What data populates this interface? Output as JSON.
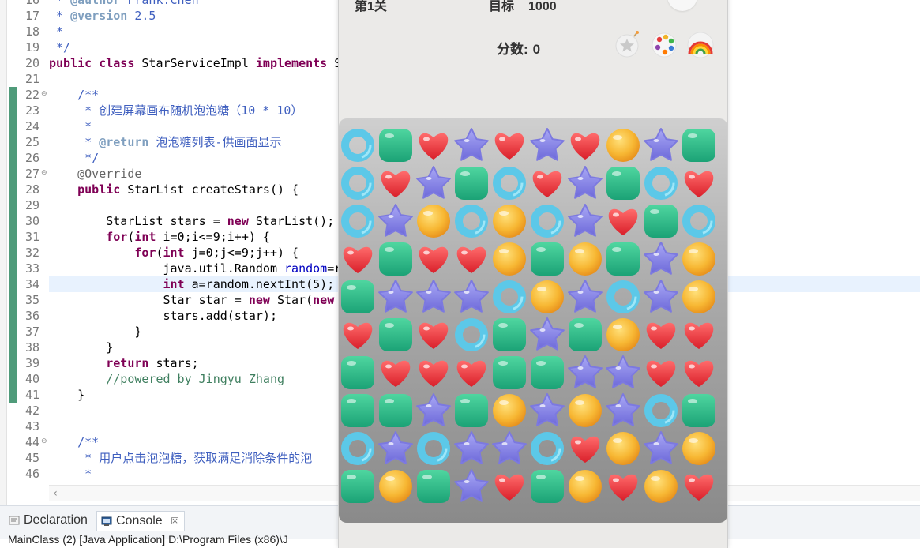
{
  "editor": {
    "line_numbers": [
      "16",
      "17",
      "18",
      "19",
      "20",
      "21",
      "22",
      "23",
      "24",
      "25",
      "26",
      "27",
      "28",
      "29",
      "30",
      "31",
      "32",
      "33",
      "34",
      "35",
      "36",
      "37",
      "38",
      "39",
      "40",
      "41",
      "42",
      "43",
      "44",
      "45",
      "46"
    ],
    "fold_markers": [
      {
        "line": "22",
        "symbol": "⊖"
      },
      {
        "line": "27",
        "symbol": "⊖"
      },
      {
        "line": "44",
        "symbol": "⊖"
      }
    ],
    "code_lines": [
      " * @author Frank.Chen",
      " * @version 2.5",
      " *",
      " */",
      "public class StarServiceImpl implements S",
      "",
      "    /**",
      "     * 创建屏幕画布随机泡泡糖（10 * 10）",
      "     *",
      "     * @return 泡泡糖列表-供画面显示",
      "     */",
      "    @Override",
      "    public StarList createStars() {",
      "",
      "        StarList stars = new StarList();",
      "        for(int i=0;i<=9;i++) {",
      "            for(int j=0;j<=9;j++) {",
      "                java.util.Random random=r",
      "                int a=random.nextInt(5);",
      "                Star star = new Star(new",
      "                stars.add(star);",
      "            }",
      "        }",
      "        return stars;",
      "        //powered by Jingyu Zhang",
      "    }",
      "",
      "",
      "    /**",
      "     * 用户点击泡泡糖，获取满足消除条件的泡",
      "     *"
    ]
  },
  "bottom_panel": {
    "tabs": [
      {
        "label": "Declaration",
        "icon": "declaration-icon"
      },
      {
        "label": "Console",
        "icon": "console-icon",
        "active": true
      }
    ],
    "close_glyph": "☒",
    "status_line": "MainClass (2) [Java Application] D:\\Program Files (x86)\\J"
  },
  "game": {
    "level_label": "第1关",
    "target_label": "目标",
    "target_value": "1000",
    "score_label": "分数:",
    "score_value": "0",
    "tools": [
      "bomb-star-icon",
      "palette-icon",
      "rainbow-icon"
    ],
    "top_button_icon": "money-bag-icon",
    "board": {
      "rows": 10,
      "cols": 10,
      "legend": {
        "R": "blue-ring",
        "G": "green-square",
        "H": "red-heart",
        "S": "purple-star",
        "O": "orange-ball"
      },
      "grid": [
        "RGHSHSHOSG",
        "RHSGRHSGRH",
        "RSORORSHGR",
        "HGHHOGOGSO",
        "GSSSROSRSO",
        "HGHRGSGOHH",
        "GHHHGGSSHH",
        "GGSGOSOSRG",
        "RSRSSRHOSO",
        "GOGSHGOHOH"
      ]
    }
  },
  "colors": {
    "green_gutter": "#4f9b7a",
    "current_line": "#e8f2fe",
    "keyword": "#7f0055",
    "javadoc": "#3f5fbf",
    "comment": "#3f7f5f"
  }
}
